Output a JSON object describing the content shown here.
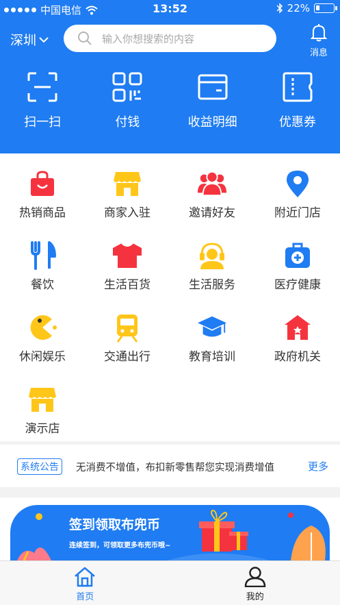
{
  "status": {
    "carrier": "中国电信",
    "time": "13:52",
    "battery": "22%",
    "battery_level": 0.22
  },
  "header": {
    "city": "深圳",
    "search_placeholder": "输入你想搜索的内容",
    "message_label": "消息"
  },
  "quick_actions": [
    {
      "label": "扫一扫",
      "icon": "scan-icon"
    },
    {
      "label": "付钱",
      "icon": "qrcode-pay-icon"
    },
    {
      "label": "收益明细",
      "icon": "wallet-card-icon"
    },
    {
      "label": "优惠券",
      "icon": "coupon-icon"
    }
  ],
  "categories": [
    {
      "label": "热销商品",
      "icon": "shopping-bag-icon",
      "color": "#f5333f"
    },
    {
      "label": "商家入驻",
      "icon": "store-icon",
      "color": "#ffc61a"
    },
    {
      "label": "邀请好友",
      "icon": "users-icon",
      "color": "#f5333f"
    },
    {
      "label": "附近门店",
      "icon": "location-pin-icon",
      "color": "#1f7cf2"
    },
    {
      "label": "餐饮",
      "icon": "fork-knife-icon",
      "color": "#1f7cf2"
    },
    {
      "label": "生活百货",
      "icon": "tshirt-icon",
      "color": "#f5333f"
    },
    {
      "label": "生活服务",
      "icon": "headset-service-icon",
      "color": "#ffc61a"
    },
    {
      "label": "医疗健康",
      "icon": "medical-kit-icon",
      "color": "#1f7cf2"
    },
    {
      "label": "休闲娱乐",
      "icon": "pacman-icon",
      "color": "#ffc61a"
    },
    {
      "label": "交通出行",
      "icon": "train-icon",
      "color": "#ffc61a"
    },
    {
      "label": "教育培训",
      "icon": "graduation-cap-icon",
      "color": "#1f7cf2"
    },
    {
      "label": "政府机关",
      "icon": "government-building-icon",
      "color": "#f5333f"
    },
    {
      "label": "演示店",
      "icon": "store-icon",
      "color": "#ffc61a"
    }
  ],
  "notice": {
    "tag": "系统公告",
    "text": "无消费不增值，布扣新零售帮您实现消费增值",
    "more": "更多"
  },
  "banner": {
    "title": "签到领取布兜币",
    "subtitle": "连续签到，可领取更多布兜币哦~"
  },
  "tabs": [
    {
      "label": "首页",
      "icon": "home-icon",
      "active": true
    },
    {
      "label": "我的",
      "icon": "user-icon",
      "active": false
    }
  ],
  "colors": {
    "primary": "#1f7cf2",
    "red": "#f5333f",
    "yellow": "#ffc61a"
  }
}
